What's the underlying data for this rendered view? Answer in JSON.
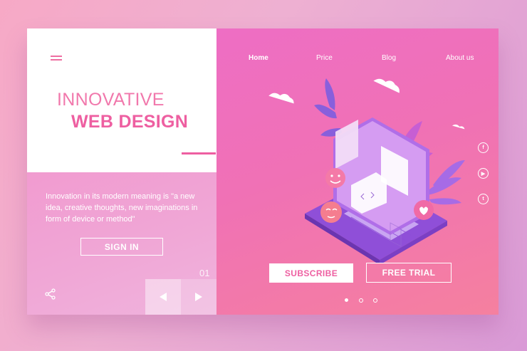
{
  "hero": {
    "title_line1": "INNOVATIVE",
    "title_line2": "WEB DESIGN",
    "description": "Innovation in its modern meaning is \"a new idea, creative thoughts, new imaginations in form of device or method\"",
    "sign_in_label": "SIGN IN",
    "page_number": "01"
  },
  "nav": {
    "items": [
      {
        "label": "Home",
        "active": true
      },
      {
        "label": "Price",
        "active": false
      },
      {
        "label": "Blog",
        "active": false
      },
      {
        "label": "About us",
        "active": false
      }
    ]
  },
  "actions": {
    "subscribe_label": "SUBSCRIBE",
    "free_trial_label": "FREE TRIAL"
  },
  "social": {
    "icons": [
      "facebook-icon",
      "youtube-icon",
      "twitter-icon"
    ]
  },
  "carousel": {
    "dots": 3,
    "active_index": 0
  },
  "colors": {
    "accent": "#ee5fa1",
    "panel_gradient_start": "#ee6ec4",
    "panel_gradient_end": "#f5809f",
    "laptop": "#9b57e0"
  }
}
